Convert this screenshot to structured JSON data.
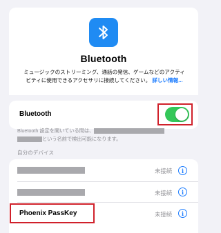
{
  "header": {
    "title": "Bluetooth",
    "description": "ミュージックのストリーミング、通話の発信、ゲームなどのアクティビティに使用できるアクセサリに接続してください。",
    "link_text": "詳しい情報..."
  },
  "toggle": {
    "label": "Bluetooth",
    "state": "on"
  },
  "visibility_note": {
    "text_part1": "Bluetooth 設定を開いている間は、",
    "text_part2": "という名前で検出可能になります。"
  },
  "devices": {
    "section_label": "自分のデバイス",
    "items": [
      {
        "name": "",
        "status": "未接続"
      },
      {
        "name": "",
        "status": "未接続"
      },
      {
        "name": "Phoenix PassKey",
        "status": "未接続"
      }
    ]
  },
  "colors": {
    "accent": "#1a7bff",
    "icon_bg": "#1f8bf3",
    "switch_on": "#34c759",
    "highlight": "#d0202a",
    "background": "#f2f2f7"
  },
  "icons": {
    "app": "bluetooth-icon",
    "info": "info-icon"
  }
}
